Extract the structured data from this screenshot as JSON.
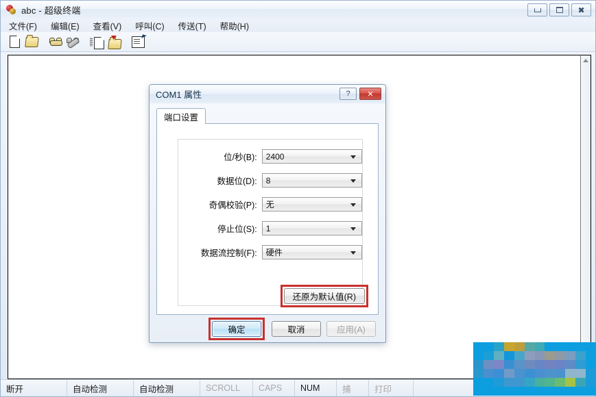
{
  "window": {
    "title": "abc - 超级终端",
    "icon": "hyperterminal-icon",
    "controls": {
      "minimize": "minimize-icon",
      "maximize": "maximize-icon",
      "close": "close-icon"
    }
  },
  "menu": {
    "items": [
      {
        "label": "文件(F)",
        "name": "menu-file"
      },
      {
        "label": "编辑(E)",
        "name": "menu-edit"
      },
      {
        "label": "查看(V)",
        "name": "menu-view"
      },
      {
        "label": "呼叫(C)",
        "name": "menu-call"
      },
      {
        "label": "传送(T)",
        "name": "menu-transfer"
      },
      {
        "label": "帮助(H)",
        "name": "menu-help"
      }
    ]
  },
  "toolbar": {
    "buttons": [
      {
        "name": "new-connection-icon",
        "title": "新建连接"
      },
      {
        "name": "open-file-icon",
        "title": "打开"
      },
      {
        "name": "call-icon",
        "title": "呼叫"
      },
      {
        "name": "disconnect-icon",
        "title": "挂断"
      },
      {
        "name": "send-file-icon",
        "title": "发送"
      },
      {
        "name": "receive-file-icon",
        "title": "接收"
      },
      {
        "name": "properties-icon",
        "title": "属性"
      }
    ]
  },
  "terminal": {
    "content": ""
  },
  "status_bar": {
    "cells": [
      {
        "label": "断开",
        "name": "status-connection",
        "dim": false
      },
      {
        "label": "自动检测",
        "name": "status-autodetect-1",
        "dim": false
      },
      {
        "label": "自动检测",
        "name": "status-autodetect-2",
        "dim": false
      },
      {
        "label": "SCROLL",
        "name": "status-scroll",
        "dim": true
      },
      {
        "label": "CAPS",
        "name": "status-caps",
        "dim": true
      },
      {
        "label": "NUM",
        "name": "status-num",
        "dim": false
      },
      {
        "label": "捕",
        "name": "status-capture",
        "dim": true
      },
      {
        "label": "打印",
        "name": "status-print",
        "dim": true
      }
    ]
  },
  "dialog": {
    "title": "COM1 属性",
    "help_button": "?",
    "close_button": "✕",
    "tabs": [
      {
        "label": "端口设置",
        "name": "tab-port-settings",
        "active": true
      }
    ],
    "fields": [
      {
        "label": "位/秒(B):",
        "value": "2400",
        "name": "bits-per-second"
      },
      {
        "label": "数据位(D):",
        "value": "8",
        "name": "data-bits"
      },
      {
        "label": "奇偶校验(P):",
        "value": "无",
        "name": "parity"
      },
      {
        "label": "停止位(S):",
        "value": "1",
        "name": "stop-bits"
      },
      {
        "label": "数据流控制(F):",
        "value": "硬件",
        "name": "flow-control"
      }
    ],
    "restore_button": "还原为默认值(R)",
    "ok_button": "确定",
    "cancel_button": "取消",
    "apply_button": "应用(A)",
    "apply_disabled": true,
    "highlight_color": "#c9302c"
  },
  "mosaic": {
    "name": "censored-watermark-block",
    "colors": [
      "#0d9ee0",
      "#0d9ee0",
      "#2aa3c9",
      "#c8a52e",
      "#bf9e3a",
      "#56a8a6",
      "#3fa9b4",
      "#0d9ee0",
      "#0d9ee0",
      "#0d9ee0",
      "#0d9ee0",
      "#0d9ee0",
      "#0d9ee0",
      "#1c9ed6",
      "#5fb0c4",
      "#1496db",
      "#4aa6c8",
      "#8d9dbd",
      "#8896b8",
      "#9b9c8e",
      "#8f9aa8",
      "#7a9dc0",
      "#3aa2cc",
      "#0d9ee0",
      "#2a95cc",
      "#6f8fc4",
      "#7d86c6",
      "#3b8fd2",
      "#5a93c6",
      "#6f8bbe",
      "#6786c4",
      "#7282c2",
      "#6a84c6",
      "#5f8cc6",
      "#2f9cd2",
      "#0d9ee0",
      "#2b97cf",
      "#4a8fcf",
      "#3d8fd4",
      "#6f9bc6",
      "#4a93cf",
      "#3d90d4",
      "#4a8fd0",
      "#4f93cc",
      "#4c92cf",
      "#8fb6cc",
      "#8fb6cc",
      "#1b9cd8",
      "#0d9ee0",
      "#0d9ee0",
      "#1f9bd8",
      "#3f97cf",
      "#3f97cf",
      "#35a5c4",
      "#49b09b",
      "#51b58e",
      "#6cbb72",
      "#a5c246",
      "#3aa6b4",
      "#1b9cd8",
      "#0d9ee0",
      "#0d9ee0",
      "#0d9ee0",
      "#0d9ee0",
      "#0d9ee0",
      "#0d9ee0",
      "#0d9ee0",
      "#0d9ee0",
      "#0d9ee0",
      "#0d9ee0",
      "#0d9ee0",
      "#0d9ee0"
    ]
  }
}
